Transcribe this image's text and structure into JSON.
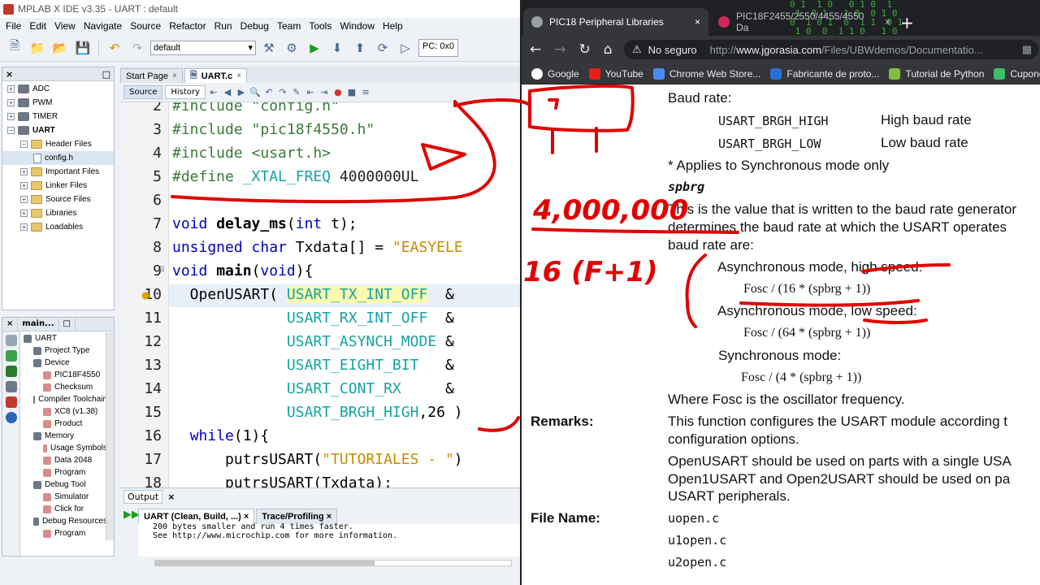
{
  "ide": {
    "title": "MPLAB X IDE v3.35 - UART : default",
    "menu": [
      "File",
      "Edit",
      "View",
      "Navigate",
      "Source",
      "Refactor",
      "Run",
      "Debug",
      "Team",
      "Tools",
      "Window",
      "Help"
    ],
    "config_select": "default",
    "pc_label": "PC: 0x0",
    "projects": {
      "items": [
        {
          "label": "ADC",
          "depth": 0,
          "kind": "project"
        },
        {
          "label": "PWM",
          "depth": 0,
          "kind": "project"
        },
        {
          "label": "TIMER",
          "depth": 0,
          "kind": "project"
        },
        {
          "label": "UART",
          "depth": 0,
          "kind": "project",
          "bold": true
        },
        {
          "label": "Header Files",
          "depth": 1,
          "kind": "folder"
        },
        {
          "label": "config.h",
          "depth": 2,
          "kind": "file",
          "selected": true
        },
        {
          "label": "Important Files",
          "depth": 1,
          "kind": "folder"
        },
        {
          "label": "Linker Files",
          "depth": 1,
          "kind": "folder"
        },
        {
          "label": "Source Files",
          "depth": 1,
          "kind": "folder"
        },
        {
          "label": "Libraries",
          "depth": 1,
          "kind": "folder"
        },
        {
          "label": "Loadables",
          "depth": 1,
          "kind": "folder"
        }
      ]
    },
    "dashboard": {
      "tab_label": "main...",
      "items": [
        {
          "label": "UART",
          "depth": 0
        },
        {
          "label": "Project Type",
          "depth": 1
        },
        {
          "label": "Device",
          "depth": 1
        },
        {
          "label": "PIC18F4550",
          "depth": 2
        },
        {
          "label": "Checksum",
          "depth": 2
        },
        {
          "label": "Compiler Toolchain",
          "depth": 1
        },
        {
          "label": "XC8 (v1.38)",
          "depth": 2
        },
        {
          "label": "Product",
          "depth": 2
        },
        {
          "label": "Memory",
          "depth": 1
        },
        {
          "label": "Usage Symbols",
          "depth": 2
        },
        {
          "label": "Data 2048",
          "depth": 2
        },
        {
          "label": "Program",
          "depth": 2
        },
        {
          "label": "Debug Tool",
          "depth": 1
        },
        {
          "label": "Simulator",
          "depth": 2
        },
        {
          "label": "Click for",
          "depth": 2
        },
        {
          "label": "Debug Resources",
          "depth": 1
        },
        {
          "label": "Program",
          "depth": 2
        }
      ]
    },
    "editor": {
      "tabs": [
        {
          "label": "Start Page",
          "active": false
        },
        {
          "label": "UART.c",
          "active": true
        }
      ],
      "source_label": "Source",
      "history_label": "History",
      "line_numbers": [
        "2",
        "3",
        "4",
        "5",
        "6",
        "7",
        "8",
        "9",
        "10",
        "11",
        "12",
        "13",
        "14",
        "15",
        "16",
        "17",
        "18"
      ]
    },
    "output": {
      "title": "Output",
      "tabs": [
        {
          "label": "UART (Clean, Build, ...)",
          "active": true
        },
        {
          "label": "Trace/Profiling",
          "active": false
        }
      ],
      "lines": [
        "200 bytes smaller and run 4 times faster.",
        "See http://www.microchip.com for more information."
      ]
    }
  },
  "browser": {
    "tabs": [
      {
        "label": "PIC18 Peripheral Libraries",
        "active": true
      },
      {
        "label": "PIC18F2455/2550/4455/4550 Da",
        "active": false
      }
    ],
    "security_label": "No seguro",
    "url_prefix": "http://",
    "url_host": "www.jgorasia.com",
    "url_path": "/Files/UBWdemos/Documentatio...",
    "bookmarks": [
      "Google",
      "YouTube",
      "Chrome Web Store...",
      "Fabricante de proto...",
      "Tutorial de Python",
      "Cupone"
    ],
    "doc": {
      "baud_rate_label": "Baud rate:",
      "brgh_high": "USART_BRGH_HIGH",
      "brgh_high_desc": "High baud rate",
      "brgh_low": "USART_BRGH_LOW",
      "brgh_low_desc": "Low baud rate",
      "sync_note": "* Applies to Synchronous mode only",
      "spbrg_label": "spbrg",
      "spbrg_desc_1": "This is the value that is written to the baud rate generator",
      "spbrg_desc_2": "determines the baud rate at which the USART operates",
      "spbrg_desc_3": "baud rate are:",
      "async_high": "Asynchronous mode, high speed:",
      "async_high_formula": "Fosc / (16 * (spbrg + 1))",
      "async_low": "Asynchronous mode, low speed:",
      "async_low_formula": "Fosc / (64 * (spbrg + 1))",
      "sync_mode": "Synchronous mode:",
      "sync_formula": "Fosc / (4 * (spbrg + 1))",
      "fosc_note": "Where Fosc is the oscillator frequency.",
      "remarks_label": "Remarks:",
      "remarks_1a": "This function configures the USART module according t",
      "remarks_1b": "configuration options.",
      "remarks_2a": "OpenUSART should be used on parts with a single USA",
      "remarks_2b": "Open1USART and Open2USART should be used on pa",
      "remarks_2c": "USART peripherals.",
      "filename_label": "File Name:",
      "files": [
        "uopen.c",
        "u1open.c",
        "u2open.c"
      ]
    }
  },
  "annotations": {
    "hand_number_1": "4,000,000",
    "hand_number_2": "16 (F+1)",
    "ink_color": "#e00000"
  }
}
